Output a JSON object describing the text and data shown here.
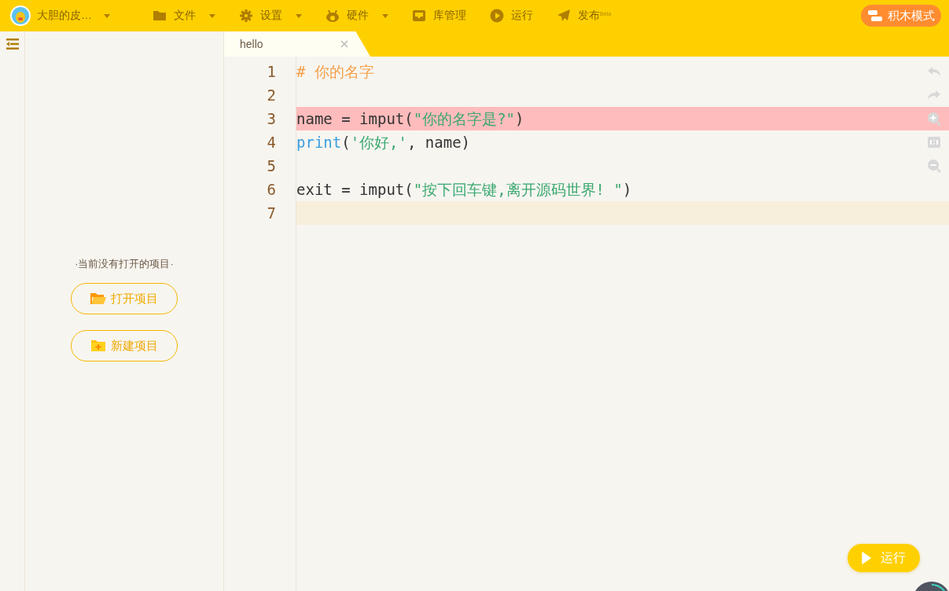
{
  "toolbar": {
    "profile": "大胆的皮…",
    "menus": [
      {
        "label": "文件",
        "kind": "folder",
        "dropdown": true
      },
      {
        "label": "设置",
        "kind": "gear",
        "dropdown": true
      },
      {
        "label": "硬件",
        "kind": "robot",
        "dropdown": true
      },
      {
        "label": "库管理",
        "kind": "inbox",
        "dropdown": false
      },
      {
        "label": "运行",
        "kind": "play",
        "dropdown": false
      },
      {
        "label": "发布",
        "kind": "send",
        "dropdown": false,
        "badge": "Beta"
      }
    ],
    "mode_button": "积木模式"
  },
  "sidebar": {
    "empty_text": "·当前没有打开的项目·",
    "buttons": [
      {
        "label": "打开项目",
        "kind": "open"
      },
      {
        "label": "新建项目",
        "kind": "new"
      }
    ]
  },
  "tabs": [
    {
      "label": "hello",
      "selected": true
    }
  ],
  "editor": {
    "lines": [
      {
        "number": "1",
        "error": false,
        "current": false,
        "tokens": [
          {
            "kind": "comment",
            "text": "# 你的名字"
          }
        ]
      },
      {
        "number": "2",
        "error": false,
        "current": false
      },
      {
        "number": "3",
        "error": true,
        "current": false,
        "tokens": [
          {
            "kind": "plain",
            "text": "name = imput("
          },
          {
            "kind": "string",
            "text": "\"你的名字是?\""
          },
          {
            "kind": "plain",
            "text": ")"
          }
        ]
      },
      {
        "number": "4",
        "error": false,
        "current": false,
        "tokens": [
          {
            "kind": "builtin",
            "text": "print"
          },
          {
            "kind": "plain",
            "text": "("
          },
          {
            "kind": "string",
            "text": "'你好,'"
          },
          {
            "kind": "plain",
            "text": ", name)"
          }
        ]
      },
      {
        "number": "5",
        "error": false,
        "current": false
      },
      {
        "number": "6",
        "error": false,
        "current": false,
        "tokens": [
          {
            "kind": "plain",
            "text": "exit = imput("
          },
          {
            "kind": "string",
            "text": "\"按下回车键,离开源码世界! \""
          },
          {
            "kind": "plain",
            "text": ")"
          }
        ]
      },
      {
        "number": "7",
        "error": false,
        "current": true
      }
    ],
    "run_button": "运行"
  }
}
